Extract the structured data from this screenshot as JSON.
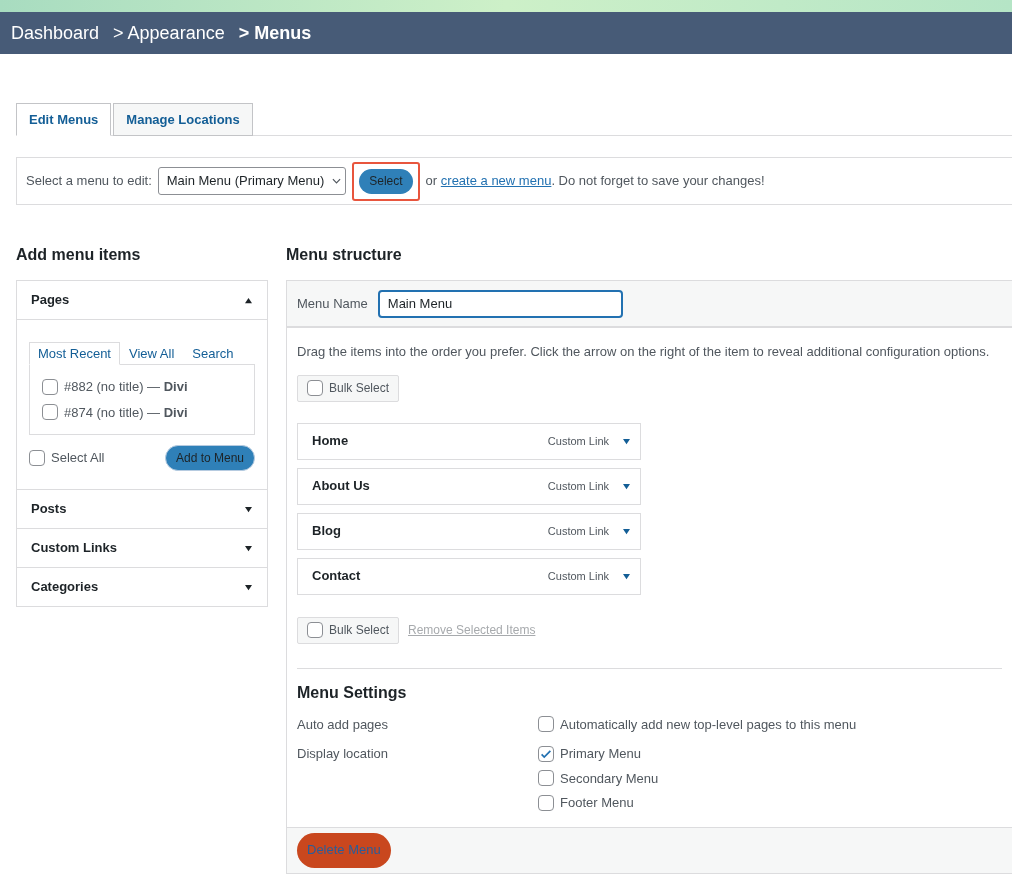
{
  "breadcrumb": [
    {
      "label": "Dashboard",
      "current": false
    },
    {
      "label": "> Appearance",
      "current": false
    },
    {
      "label": "> Menus",
      "current": true
    }
  ],
  "tabs": [
    {
      "label": "Edit Menus",
      "selected": true
    },
    {
      "label": "Manage Locations",
      "selected": false
    }
  ],
  "menu_select": {
    "label": "Select a menu to edit:",
    "value": "Main Menu (Primary Menu)",
    "button": "Select",
    "highlighted": true,
    "before_link": "or",
    "link": "create a new menu",
    "after_link": ". Do not forget to save your changes!"
  },
  "add_items": {
    "title": "Add menu items",
    "sections": [
      {
        "title": "Pages",
        "expanded": true,
        "subtabs": [
          {
            "label": "Most Recent",
            "selected": true
          },
          {
            "label": "View All",
            "selected": false
          },
          {
            "label": "Search",
            "selected": false
          }
        ],
        "items": [
          {
            "text": "#882 (no title) — **Divi**",
            "checked": false
          },
          {
            "text": "#874 (no title) — **Divi**",
            "checked": false
          }
        ],
        "select_all": {
          "label": "Select All",
          "checked": false
        },
        "button": "Add to Menu"
      },
      {
        "title": "Posts",
        "expanded": false
      },
      {
        "title": "Custom Links",
        "expanded": false
      },
      {
        "title": "Categories",
        "expanded": false
      }
    ]
  },
  "structure": {
    "title": "Menu structure",
    "name_label": "Menu Name",
    "name_value": "Main Menu",
    "instructions": "Drag the items into the order you prefer. Click the arrow on the right of the item to reveal additional configuration options.",
    "bulk_select": [
      {
        "label": "Bulk Select",
        "checked": false
      },
      {
        "label": "Bulk Select",
        "checked": false
      }
    ],
    "items": [
      {
        "title": "Home",
        "type": "Custom Link"
      },
      {
        "title": "About Us",
        "type": "Custom Link"
      },
      {
        "title": "Blog",
        "type": "Custom Link"
      },
      {
        "title": "Contact",
        "type": "Custom Link"
      }
    ],
    "remove_link": "Remove Selected Items",
    "settings": {
      "title": "Menu Settings",
      "rows": [
        {
          "label": "Auto add pages",
          "options": [
            {
              "label": "Automatically add new top-level pages to this menu",
              "checked": false
            }
          ]
        },
        {
          "label": "Display location",
          "options": [
            {
              "label": "Primary Menu",
              "checked": true
            },
            {
              "label": "Secondary Menu",
              "checked": false
            },
            {
              "label": "Footer Menu",
              "checked": false
            }
          ]
        }
      ]
    },
    "delete_button": "Delete Menu"
  }
}
